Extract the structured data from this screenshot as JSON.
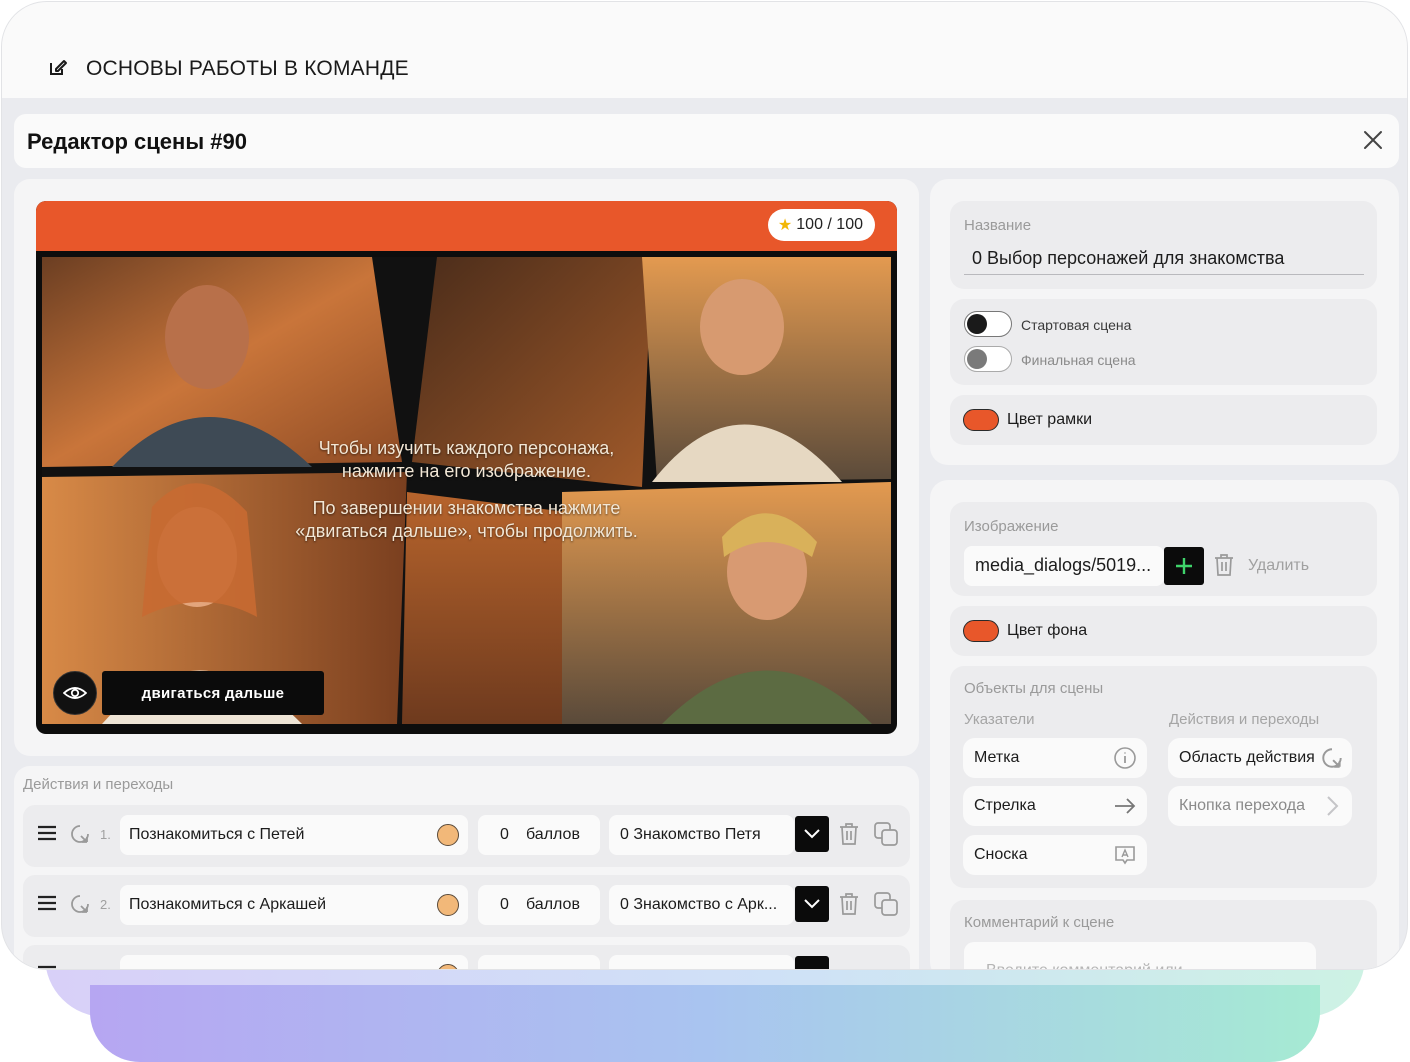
{
  "app": {
    "title": "ОСНОВЫ РАБОТЫ В КОМАНДЕ"
  },
  "editor": {
    "title": "Редактор сцены #90"
  },
  "preview": {
    "score": "100 / 100",
    "text_line1": "Чтобы изучить каждого персонажа,",
    "text_line2": "нажмите на его изображение.",
    "text_line3": "По завершении знакомства нажмите",
    "text_line4": "«двигаться дальше», чтобы продолжить.",
    "move_button": "двигаться дальше",
    "frame_color": "#e8572a"
  },
  "actions": {
    "label": "Действия и переходы",
    "rows": [
      {
        "index": "1.",
        "name": "Познакомиться с Петей",
        "points": "0",
        "unit": "баллов",
        "target": "0 Знакомство Петя"
      },
      {
        "index": "2.",
        "name": "Познакомиться с Аркашей",
        "points": "0",
        "unit": "баллов",
        "target": "0 Знакомство с Арк..."
      }
    ]
  },
  "settings": {
    "name_label": "Название",
    "name_value": "0 Выбор персонажей для знакомства",
    "start_scene": "Стартовая сцена",
    "final_scene": "Финальная сцена",
    "frame_color_label": "Цвет рамки",
    "image_label": "Изображение",
    "image_value": "media_dialogs/5019...",
    "delete_label": "Удалить",
    "bg_color_label": "Цвет фона",
    "objects_label": "Объекты для сцены",
    "pointers_label": "Указатели",
    "actions_label": "Действия и переходы",
    "pointers": [
      "Метка",
      "Стрелка",
      "Сноска"
    ],
    "action_objects": [
      "Область действия",
      "Кнопка перехода"
    ],
    "comment_label": "Комментарий к сцене",
    "comment_placeholder": "Введите комментарий или"
  },
  "colors": {
    "accent": "#e8572a",
    "panel": "#f5f5f6",
    "card": "#ececee"
  }
}
